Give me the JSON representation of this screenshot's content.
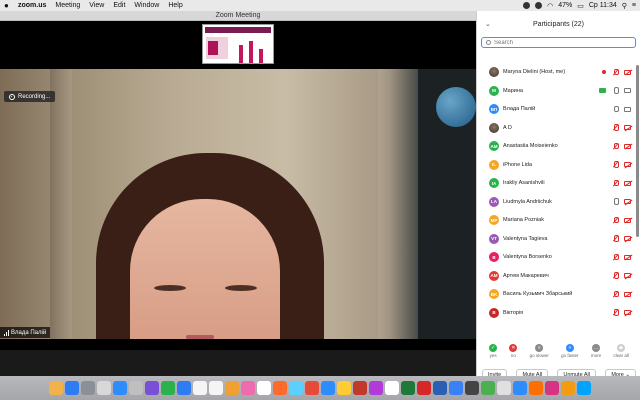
{
  "menubar": {
    "app": "zoom.us",
    "menus": [
      "Meeting",
      "View",
      "Edit",
      "Window",
      "Help"
    ],
    "battery": "47%",
    "clock": "Ср 11:34"
  },
  "window": {
    "title": "Zoom Meeting"
  },
  "stage": {
    "recording_label": "Recording...",
    "speaker_name": "Влада Палій"
  },
  "panel": {
    "title": "Participants (22)",
    "search_placeholder": "Search",
    "participants": [
      {
        "initials": "",
        "photo": true,
        "color": "#555555",
        "name": "Maryna Dielini (Host, me)",
        "mic": "muted",
        "cam": "off",
        "host_dot": true
      },
      {
        "initials": "M",
        "color": "#2bb24c",
        "name": "Марина",
        "mic": "on",
        "cam": "on",
        "sharing": true
      },
      {
        "initials": "ВП",
        "color": "#2d8cff",
        "name": "Влада Палій",
        "mic": "on",
        "cam": "on"
      },
      {
        "initials": "",
        "photo": true,
        "color": "#555555",
        "name": "A D",
        "mic": "muted",
        "cam": "off"
      },
      {
        "initials": "AM",
        "color": "#2bb24c",
        "name": "Anastasiia Moiseienko",
        "mic": "muted",
        "cam": "off"
      },
      {
        "initials": "IL",
        "color": "#f5a623",
        "name": "iPhone Lida",
        "mic": "muted",
        "cam": "off"
      },
      {
        "initials": "IA",
        "color": "#2bb24c",
        "name": "Irakliy Asanishvili",
        "mic": "muted",
        "cam": "off"
      },
      {
        "initials": "LA",
        "color": "#9b59b6",
        "name": "Liudmyla Andriichuk",
        "mic": "on",
        "cam": "off"
      },
      {
        "initials": "MP",
        "color": "#f5a623",
        "name": "Mariana Pozniak",
        "mic": "muted",
        "cam": "off"
      },
      {
        "initials": "VT",
        "color": "#9b59b6",
        "name": "Valentyna Tagieva",
        "mic": "muted",
        "cam": "off"
      },
      {
        "initials": "B",
        "color": "#e91e63",
        "name": "Valentyna Borsenko",
        "mic": "muted",
        "cam": "off"
      },
      {
        "initials": "AM",
        "color": "#e53935",
        "name": "Артем Макаревич",
        "mic": "muted",
        "cam": "off"
      },
      {
        "initials": "BK",
        "color": "#f5a623",
        "name": "Василь Кузьмич Збарський",
        "mic": "muted",
        "cam": "off"
      },
      {
        "initials": "B",
        "color": "#c62828",
        "name": "Вікторія",
        "mic": "muted",
        "cam": "off"
      }
    ],
    "reactions": [
      {
        "label": "yes",
        "glyph": "✓",
        "color": "#2bb24c"
      },
      {
        "label": "no",
        "glyph": "✕",
        "color": "#e53935"
      },
      {
        "label": "go slower",
        "glyph": "«",
        "color": "#8a8a8a"
      },
      {
        "label": "go faster",
        "glyph": "»",
        "color": "#2d8cff"
      },
      {
        "label": "more",
        "glyph": "…",
        "color": "#8a8a8a"
      },
      {
        "label": "clear all",
        "glyph": "◆",
        "color": "#cfcfcf"
      }
    ],
    "buttons": {
      "invite": "Invite",
      "mute_all": "Mute All",
      "unmute_all": "Unmute All",
      "more": "More ⌄"
    }
  },
  "dock": {
    "app_colors": [
      "#f2b24a",
      "#2d7cf6",
      "#8a8f98",
      "#d8d8d8",
      "#2d8cff",
      "#bfbfbf",
      "#7a4fd8",
      "#2bb24c",
      "#2d7cf6",
      "#f5f5f5",
      "#f5f5f5",
      "#f0a030",
      "#f06ab0",
      "#ffffff",
      "#ff6a2a",
      "#5ad0ff",
      "#e64a3b",
      "#2d8cff",
      "#ffcc33",
      "#c0392b",
      "#b13bd8",
      "#ffffff",
      "#1f7a3a",
      "#d62828",
      "#2b5fb4",
      "#3a80f6",
      "#444444",
      "#4caf50",
      "#e0e0e0",
      "#2d8cff",
      "#ff6f00",
      "#d63384",
      "#f39c12",
      "#00a3ff"
    ]
  }
}
